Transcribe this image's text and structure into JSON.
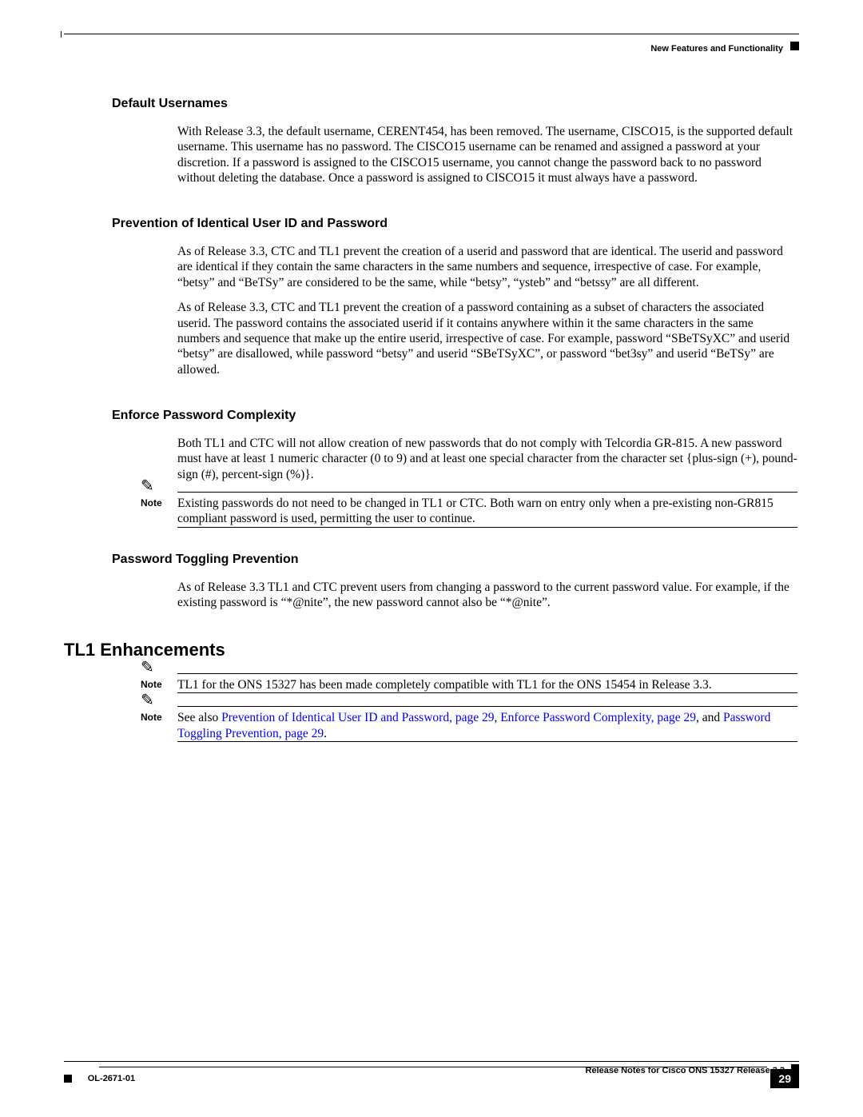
{
  "header": {
    "running_title": "New Features and Functionality"
  },
  "sections": {
    "s1": {
      "heading": "Default Usernames",
      "p1": "With Release 3.3, the default username, CERENT454, has been removed.  The username, CISCO15, is the supported default username. This username has no password. The CISCO15 username can be renamed and assigned a password at your discretion.  If a password is assigned to the CISCO15 username, you cannot change the password back to no password without deleting the database.  Once a password is assigned to CISCO15 it must always have a password."
    },
    "s2": {
      "heading": "Prevention of Identical User ID and Password",
      "p1": "As of Release 3.3, CTC and TL1 prevent the creation of a userid and password that are identical. The userid and password are identical if they contain the same characters in the same numbers and sequence, irrespective of case.  For example, “betsy” and “BeTSy” are considered to be the same, while “betsy”, “ysteb” and “betssy” are all different.",
      "p2": "As of Release 3.3, CTC and TL1 prevent the creation of a password containing as a subset of characters the associated userid. The password contains the associated userid if it contains anywhere within it the same characters in the same numbers and sequence that make up the entire userid, irrespective of case. For example, password “SBeTSyXC” and userid “betsy” are disallowed, while password “betsy” and userid “SBeTSyXC”, or password “bet3sy” and userid “BeTSy” are allowed."
    },
    "s3": {
      "heading": "Enforce Password Complexity",
      "p1": "Both TL1 and CTC will not allow creation of new passwords that do not comply with Telcordia GR-815. A new password must have at least 1 numeric character (0 to 9) and at least one special character from the character set {plus-sign (+), pound-sign (#), percent-sign (%)}.",
      "note1": "Existing passwords do not need to be changed in TL1 or CTC. Both warn on entry only when a pre-existing non-GR815 compliant password is used, permitting the user to continue."
    },
    "s4": {
      "heading": "Password Toggling Prevention",
      "p1": "As of Release 3.3 TL1 and CTC prevent users from changing a password to the current password value. For example, if the existing password is “*@nite”, the new password cannot also be “*@nite”."
    },
    "major": {
      "heading": "TL1 Enhancements",
      "note1": "TL1 for the ONS 15327 has been made completely compatible with TL1 for the ONS 15454 in Release 3.3.",
      "note2_prefix": "See also ",
      "note2_link1": "Prevention of Identical User ID and Password, page 29",
      "note2_mid1": ", ",
      "note2_link2": "Enforce Password Complexity, page 29",
      "note2_mid2": ", and ",
      "note2_link3": "Password Toggling Prevention, page 29",
      "note2_suffix": "."
    }
  },
  "labels": {
    "note": "Note"
  },
  "footer": {
    "doc_title": "Release Notes for Cisco ONS 15327 Release 3.3",
    "doc_id": "OL-2671-01",
    "page_number": "29"
  }
}
